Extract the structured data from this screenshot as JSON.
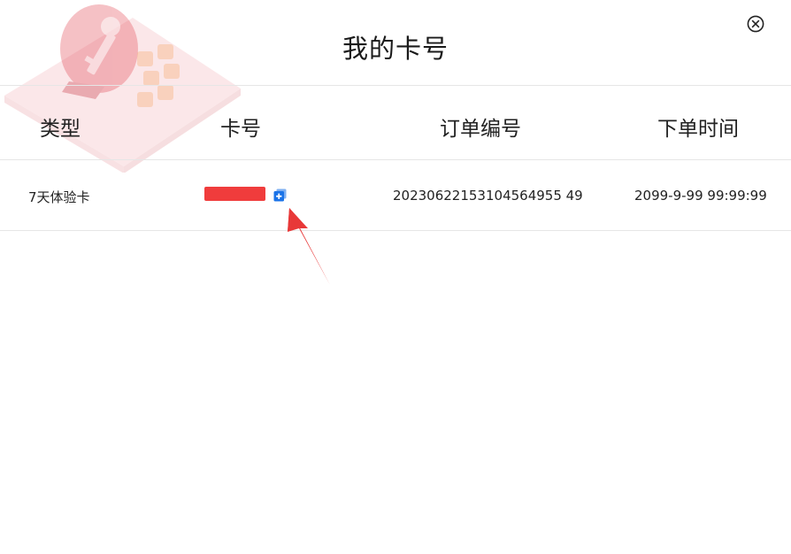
{
  "dialog": {
    "title": "我的卡号"
  },
  "table": {
    "headers": [
      "类型",
      "卡号",
      "订单编号",
      "下单时间"
    ],
    "rows": [
      {
        "type": "7天体验卡",
        "card_number": "",
        "order_id": "20230622153104564955 49",
        "order_time": "2099-9-99 99:99:99"
      }
    ]
  },
  "icons": {
    "close": "close-circle-icon",
    "copy": "copy-icon",
    "decoration": "key-card-icon"
  },
  "colors": {
    "redaction": "#f03c3c",
    "copy_icon": "#1a73e8",
    "annotation_arrow": "#e83838",
    "divider": "#e6e6e6"
  }
}
